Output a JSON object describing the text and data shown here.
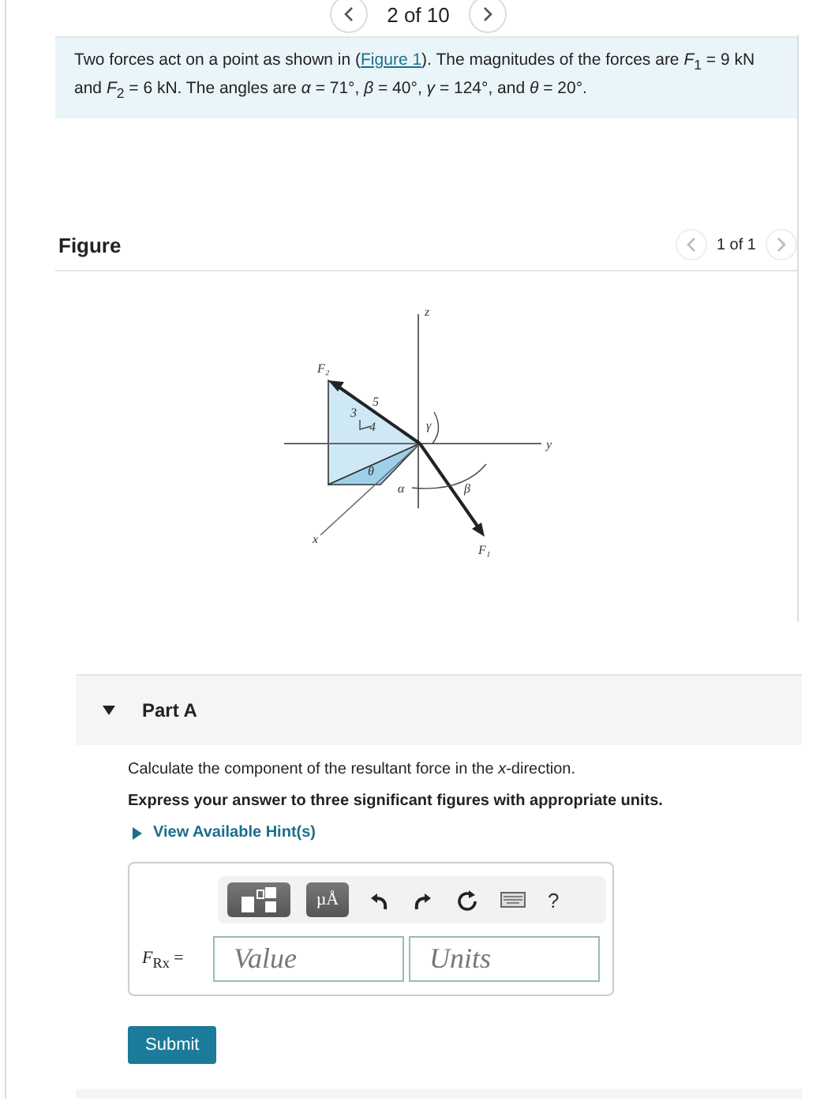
{
  "pager": {
    "text": "2 of 10"
  },
  "problem": {
    "before": "Two forces act on a point as shown in (",
    "link": "Figure 1",
    "after": "). The magnitudes of the forces are *F*$_{1}$ = 9 kN and *F*$_{2}$ = 6 kN. The angles are *α* = 71°, *β* = 40°, *γ* = 124°, and *θ* = 20°."
  },
  "figure": {
    "title": "Figure",
    "pager": "1 of 1",
    "labels": [
      {
        "kind": "f2",
        "text": "F₂"
      },
      {
        "kind": "z",
        "text": "z"
      },
      {
        "kind": "y",
        "text": "y"
      },
      {
        "kind": "x",
        "text": "x"
      },
      {
        "kind": "f1",
        "text": "F₁"
      },
      {
        "kind": "theta",
        "text": "θ"
      },
      {
        "kind": "alpha",
        "text": "α"
      },
      {
        "kind": "beta",
        "text": "β"
      },
      {
        "kind": "gamma",
        "text": "γ"
      },
      {
        "kind": "three",
        "text": "3"
      },
      {
        "kind": "four",
        "text": "4"
      },
      {
        "kind": "five",
        "text": "5"
      }
    ]
  },
  "part": {
    "label": "Part A",
    "expanded": true,
    "question": "Calculate the component of the resultant force in the *x*-direction.",
    "instruction": "Express your answer to three significant figures with appropriate units.",
    "hint": {
      "text": "View Available Hint(s)",
      "expanded": false
    },
    "toolbar": {
      "units_button": "µÅ",
      "help": "?"
    },
    "answer_label": "*F*$_{Rx}$ =",
    "value_placeholder": "Value",
    "units_placeholder": "Units",
    "submit": "Submit"
  }
}
